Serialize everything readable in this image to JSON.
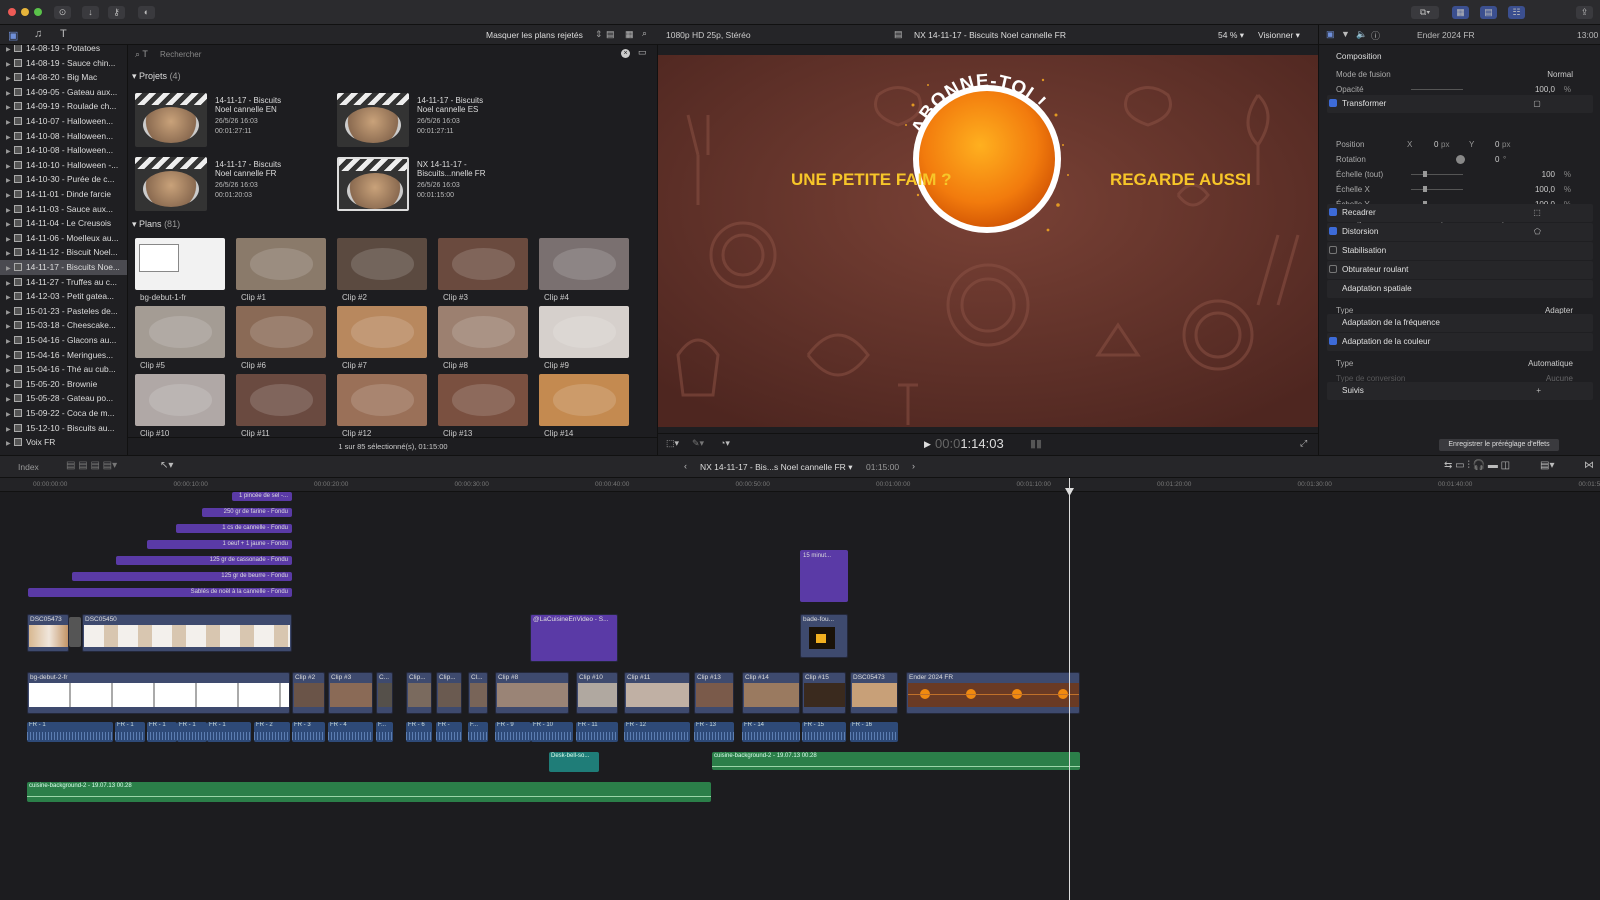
{
  "toolbar": {
    "masquer": "Masquer les plans rejetés",
    "format": "1080p HD 25p, Stéréo",
    "project_title": "NX 14-11-17 - Biscuits Noel cannelle FR",
    "zoom": "54 %",
    "visionner": "Visionner",
    "inspector_title": "Ender 2024 FR",
    "inspector_time": "13:00"
  },
  "library": {
    "items": [
      "14-08-19 - Potatoes",
      "14-08-19 - Sauce chin...",
      "14-08-20 - Big Mac",
      "14-09-05 - Gateau aux...",
      "14-09-19 - Roulade ch...",
      "14-10-07 - Halloween...",
      "14-10-08 - Halloween...",
      "14-10-08 - Halloween...",
      "14-10-10 - Halloween -...",
      "14-10-30 - Purée de c...",
      "14-11-01 - Dinde farcie",
      "14-11-03 - Sauce aux...",
      "14-11-04 - Le Creusois",
      "14-11-06 - Moelleux au...",
      "14-11-12 - Biscuit Noel...",
      "14-11-17 - Biscuits Noe...",
      "14-11-27 - Truffes au c...",
      "14-12-03 - Petit gatea...",
      "15-01-23 - Pasteles de...",
      "15-03-18 - Cheescake...",
      "15-04-16 - Glacons au...",
      "15-04-16 - Meringues...",
      "15-04-16 - Thé au cub...",
      "15-05-20 - Brownie",
      "15-05-28 - Gateau po...",
      "15-09-22 - Coca de m...",
      "15-12-10 - Biscuits au...",
      "Voix FR"
    ],
    "selected_index": 15
  },
  "browser": {
    "search_placeholder": "Rechercher",
    "projects_header": "Projets",
    "projects_count": "(4)",
    "projects": [
      {
        "line1": "14-11-17 - Biscuits",
        "line2": "Noel cannelle EN",
        "date": "26/5/26 16:03",
        "dur": "00:01:27:11"
      },
      {
        "line1": "14-11-17 - Biscuits",
        "line2": "Noel cannelle ES",
        "date": "26/5/26 16:03",
        "dur": "00:01:27:11"
      },
      {
        "line1": "14-11-17 - Biscuits",
        "line2": "Noel cannelle FR",
        "date": "26/5/26 16:03",
        "dur": "00:01:20:03"
      },
      {
        "line1": "NX 14-11-17 -",
        "line2": "Biscuits...nnelle FR",
        "date": "26/5/26 16:03",
        "dur": "00:01:15:00"
      }
    ],
    "plans_header": "Plans",
    "plans_count": "(81)",
    "clips": [
      "bg-debut-1-fr",
      "Clip #1",
      "Clip #2",
      "Clip #3",
      "Clip #4",
      "Clip #5",
      "Clip #6",
      "Clip #7",
      "Clip #8",
      "Clip #9",
      "Clip #10",
      "Clip #11",
      "Clip #12",
      "Clip #13",
      "Clip #14"
    ],
    "status": "1 sur 85 sélectionné(s), 01:15:00"
  },
  "viewer": {
    "left_text": "UNE PETITE FAIM ?",
    "right_text": "REGARDE AUSSI",
    "badge": "ABONNE-TOI !",
    "timecode_dim": "00:0",
    "timecode": "1:14:03"
  },
  "inspector": {
    "composition": "Composition",
    "fusion_label": "Mode de fusion",
    "fusion_value": "Normal",
    "opacity_label": "Opacité",
    "opacity_value": "100,0",
    "pct": "%",
    "transformer": "Transformer",
    "position": "Position",
    "rotation": "Rotation",
    "echelle_tout": "Échelle (tout)",
    "echelle_x": "Échelle X",
    "echelle_y": "Échelle Y",
    "ancrage": "Ancrage",
    "x": "X",
    "y": "Y",
    "px": "px",
    "zero": "0",
    "deg": "°",
    "hundred": "100",
    "hundred_dec": "100,0",
    "recadrer": "Recadrer",
    "distorsion": "Distorsion",
    "stabilisation": "Stabilisation",
    "obturateur": "Obturateur roulant",
    "adapt_spatiale": "Adaptation spatiale",
    "type_label": "Type",
    "type_value": "Adapter",
    "adapt_freq": "Adaptation de la fréquence",
    "adapt_couleur": "Adaptation de la couleur",
    "type2_value": "Automatique",
    "conversion_label": "Type de conversion",
    "conversion_value": "Aucune",
    "suivis": "Suivis",
    "plus": "+",
    "save_preset": "Enregistrer le préréglage d'effets"
  },
  "timeline": {
    "index": "Index",
    "project_name": "NX 14-11-17 - Bis...s Noel cannelle FR",
    "duration": "01:15:00",
    "ticks": [
      "00:00:00:00",
      "00:00:10:00",
      "00:00:20:00",
      "00:00:30:00",
      "00:00:40:00",
      "00:00:50:00",
      "00:01:00:00",
      "00:01:10:00",
      "00:01:20:00",
      "00:01:30:00",
      "00:01:40:00",
      "00:01:50:00"
    ],
    "titles": [
      "1 pincée de sel -...",
      "250 gr de farine - Fondu",
      "1 cs de cannelle - Fondu",
      "1 oeuf + 1 jaune - Fondu",
      "125 gr de cassonade - Fondu",
      "125 gr de beurre - Fondu",
      "Sablés de noël à la cannelle - Fondu",
      "15 minut..."
    ],
    "connected": [
      "DSC05473",
      "DSC05450",
      "@LaCuisineEnVideo - S...",
      "bade-fou..."
    ],
    "primary": [
      "bg-debut-2-fr",
      "Clip #2",
      "Clip #3",
      "C...",
      "Clip...",
      "Clip...",
      "Cl...",
      "Clip #8",
      "Clip #10",
      "Clip #11",
      "Clip #13",
      "Clip #14",
      "Clip #15",
      "DSC05473",
      "Ender 2024 FR"
    ],
    "audio": [
      "FR - 1",
      "FR - 1",
      "FR - 1",
      "FR - 1",
      "FR - 1",
      "FR - 2",
      "FR - 3",
      "FR - 4",
      "F...",
      "FR - 6",
      "FR -",
      "F...",
      "FR - 9",
      "FR - 10",
      "FR - 11",
      "FR - 12",
      "FR - 13",
      "FR - 14",
      "FR - 15",
      "FR - 16"
    ],
    "music1": "cuisine-background-2 - 19.07.13 00.28",
    "music2": "cuisine-background-2 - 19.07.13 00.28",
    "desk": "Desk-bell-so..."
  },
  "colors": {
    "accent": "#3d6bd8",
    "title_clip": "#5a3aa6",
    "audio_green": "#2b7f49",
    "video_blue": "#3e4a6e",
    "badge_orange": "#f07a10",
    "bg_brown": "#6b3a2e"
  }
}
